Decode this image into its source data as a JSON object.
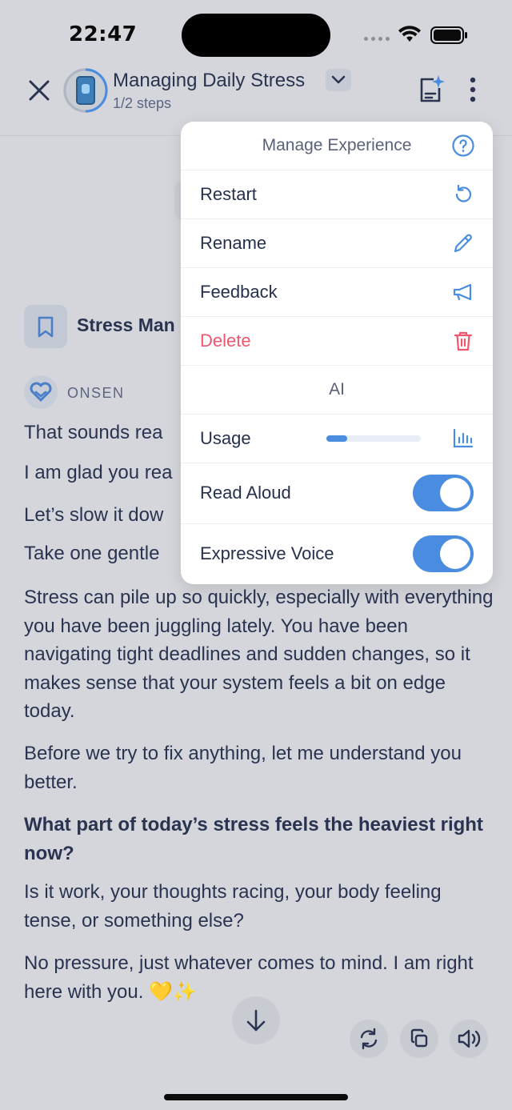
{
  "status": {
    "time": "22:47"
  },
  "header": {
    "title": "Managing Daily Stress",
    "steps": "1/2 steps"
  },
  "card": {
    "title": "Stress Man"
  },
  "assistant": {
    "name": "ONSEN"
  },
  "messages": [
    "That sounds rea",
    "I am glad you rea",
    "Let’s slow it dow",
    "Take one gentle",
    "Stress can pile up so quickly, especially with everything you have been juggling lately. You have been navigating tight deadlines and sudden changes, so it makes sense that your system feels a bit on edge today.",
    "Before we try to fix anything, let me understand you better.",
    "What part of today’s stress feels the heaviest right now?",
    "Is it work, your thoughts racing, your body feeling tense, or something else?",
    "No pressure, just whatever comes to mind. I am right here with you."
  ],
  "emoji": "💛✨",
  "menu": {
    "header": "Manage Experience",
    "items": {
      "restart": "Restart",
      "rename": "Rename",
      "feedback": "Feedback",
      "delete": "Delete"
    },
    "ai_section": "AI",
    "usage": {
      "label": "Usage",
      "level_fraction": 0.22
    },
    "read_aloud": {
      "label": "Read Aloud",
      "enabled": true
    },
    "expressive_voice": {
      "label": "Expressive Voice",
      "enabled": true
    }
  },
  "colors": {
    "accent": "#4a8de0",
    "danger": "#f0566d",
    "text": "#2a3350",
    "backdrop": "#d4d6db"
  },
  "icons": [
    "close-icon",
    "chevron-down-icon",
    "notes-sparkle-icon",
    "more-vertical-icon",
    "bookmark-icon",
    "onsen-heart-icon",
    "help-circle-icon",
    "restart-icon",
    "pencil-icon",
    "megaphone-icon",
    "trash-icon",
    "bar-chart-icon",
    "arrow-down-icon",
    "refresh-icon",
    "copy-icon",
    "speaker-icon"
  ]
}
